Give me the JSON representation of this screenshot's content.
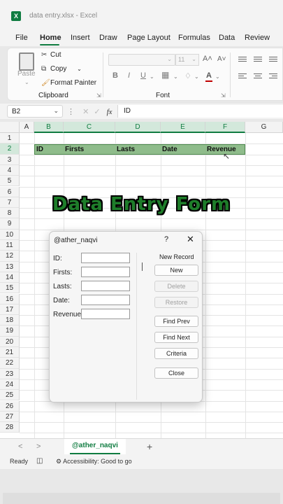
{
  "window": {
    "title": "data entry.xlsx  -  Excel",
    "logo": "X"
  },
  "menu": [
    "File",
    "Home",
    "Insert",
    "Draw",
    "Page Layout",
    "Formulas",
    "Data",
    "Review"
  ],
  "ribbon": {
    "paste": "Paste",
    "cut": "Cut",
    "copy": "Copy",
    "format_painter": "Format Painter",
    "clipboard": "Clipboard",
    "font_group": "Font",
    "font_size": "11",
    "bold": "B",
    "italic": "I",
    "underline": "U",
    "grow_font": "A˄",
    "shrink_font": "A˅",
    "font_color": "A"
  },
  "formula_bar": {
    "cell": "B2",
    "fx": "fx",
    "content": "ID"
  },
  "grid": {
    "columns": [
      "A",
      "B",
      "C",
      "D",
      "E",
      "F",
      "G"
    ],
    "selected_columns": [
      "B",
      "C",
      "D",
      "E",
      "F"
    ],
    "rows": [
      "1",
      "2",
      "3",
      "4",
      "5",
      "6",
      "7",
      "8",
      "9",
      "10",
      "11",
      "12",
      "13",
      "14",
      "15",
      "16",
      "17",
      "18",
      "19",
      "20",
      "21",
      "22",
      "23",
      "24",
      "25",
      "26",
      "27",
      "28"
    ],
    "selected_row": "2",
    "headers": [
      "ID",
      "Firsts",
      "Lasts",
      "Date",
      "Revenue"
    ],
    "header_fill": "#8fbc8b"
  },
  "banner": {
    "text": "Data Entry Form",
    "color": "#1e7d2a"
  },
  "dialog": {
    "title": "@ather_naqvi",
    "help": "?",
    "close": "✕",
    "fields": [
      "ID:",
      "Firsts:",
      "Lasts:",
      "Date:",
      "Revenue:"
    ],
    "record_label": "New Record",
    "buttons": {
      "new": "New",
      "delete": "Delete",
      "restore": "Restore",
      "find_prev": "Find Prev",
      "find_next": "Find Next",
      "criteria": "Criteria",
      "close": "Close"
    }
  },
  "sheet_tabs": {
    "active": "@ather_naqvi",
    "add": "+",
    "prev": "<",
    "next": ">"
  },
  "status": {
    "ready": "Ready",
    "accessibility": "Accessibility: Good to go"
  },
  "accent_color": "#107c41"
}
